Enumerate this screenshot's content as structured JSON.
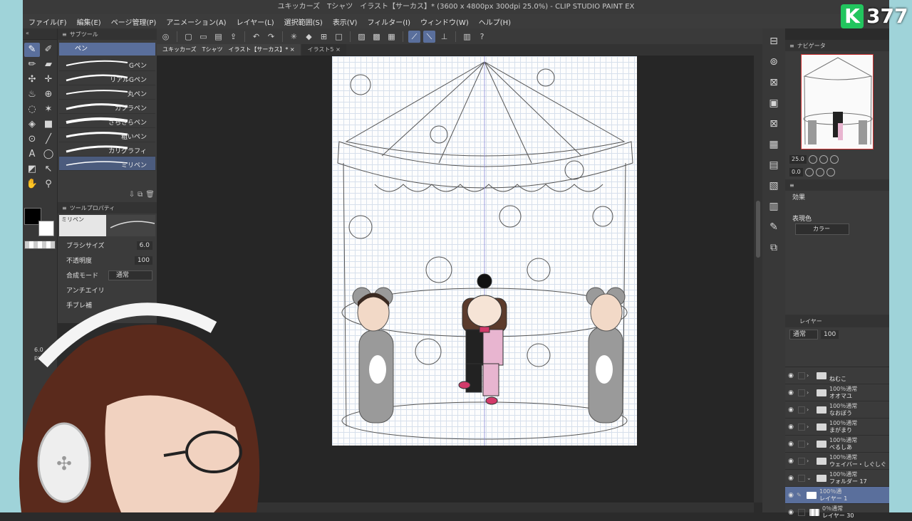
{
  "window_title": "ユキッカーズ　Tシャツ　イラスト【サーカス】* (3600 x 4800px 300dpi 25.0%) - CLIP STUDIO PAINT EX",
  "menu": [
    "ファイル(F)",
    "編集(E)",
    "ページ管理(P)",
    "アニメーション(A)",
    "レイヤー(L)",
    "選択範囲(S)",
    "表示(V)",
    "フィルター(I)",
    "ウィンドウ(W)",
    "ヘルプ(H)"
  ],
  "subtool": {
    "header": "サブツール",
    "group": "ペン",
    "brushes": [
      "Gペン",
      "リアルGペン",
      "丸ペン",
      "カブラペン",
      "さらさらペン",
      "粗いペン",
      "カリグラフィ",
      "ミリペン"
    ],
    "selected": "ミリペン"
  },
  "toolprop": {
    "header": "ツールプロパティ",
    "preview_name": "ミリペン",
    "brush_size_label": "ブラシサイズ",
    "brush_size_value": "6.0",
    "opacity_label": "不透明度",
    "opacity_value": "100",
    "blend_label": "合成モード",
    "blend_value": "通常",
    "aa_label": "アンチエイリ",
    "stab_label": "手ブレ補"
  },
  "cursor_size": {
    "value": "6.0",
    "unit": "px"
  },
  "doc_tabs": [
    {
      "label": "ユキッカーズ　Tシャツ　イラスト【サーカス】*",
      "active": true
    },
    {
      "label": "イラスト5",
      "active": false
    }
  ],
  "navigator": {
    "header": "ナビゲータ",
    "zoom": "25.0",
    "angle": "0.0"
  },
  "layer_property": {
    "effect_label": "効果",
    "expression_label": "表現色",
    "expression_value": "カラー"
  },
  "layer_panel": {
    "header": "レイヤー",
    "blend": "通常",
    "opacity": "100",
    "layers": [
      {
        "pct": "",
        "name": "ねむこ",
        "type": "folder"
      },
      {
        "pct": "100％通常",
        "name": "オオマユ",
        "type": "folder"
      },
      {
        "pct": "100％通常",
        "name": "なおぼう",
        "type": "folder"
      },
      {
        "pct": "100％通常",
        "name": "まがまり",
        "type": "folder"
      },
      {
        "pct": "100％通常",
        "name": "べるしあ",
        "type": "folder"
      },
      {
        "pct": "100％通常",
        "name": "ウェイバー・しぐしぐ",
        "type": "folder"
      },
      {
        "pct": "100％通常",
        "name": "フォルダー 17",
        "type": "folder-open"
      },
      {
        "pct": "100％通",
        "name": "レイヤー 1",
        "type": "layer",
        "selected": true
      },
      {
        "pct": "0％通常",
        "name": "レイヤー 30",
        "type": "layer"
      }
    ]
  },
  "viewer_count": "377",
  "accent_color": "#5a6f9c",
  "stream_bg_color": "#9fd3d9"
}
